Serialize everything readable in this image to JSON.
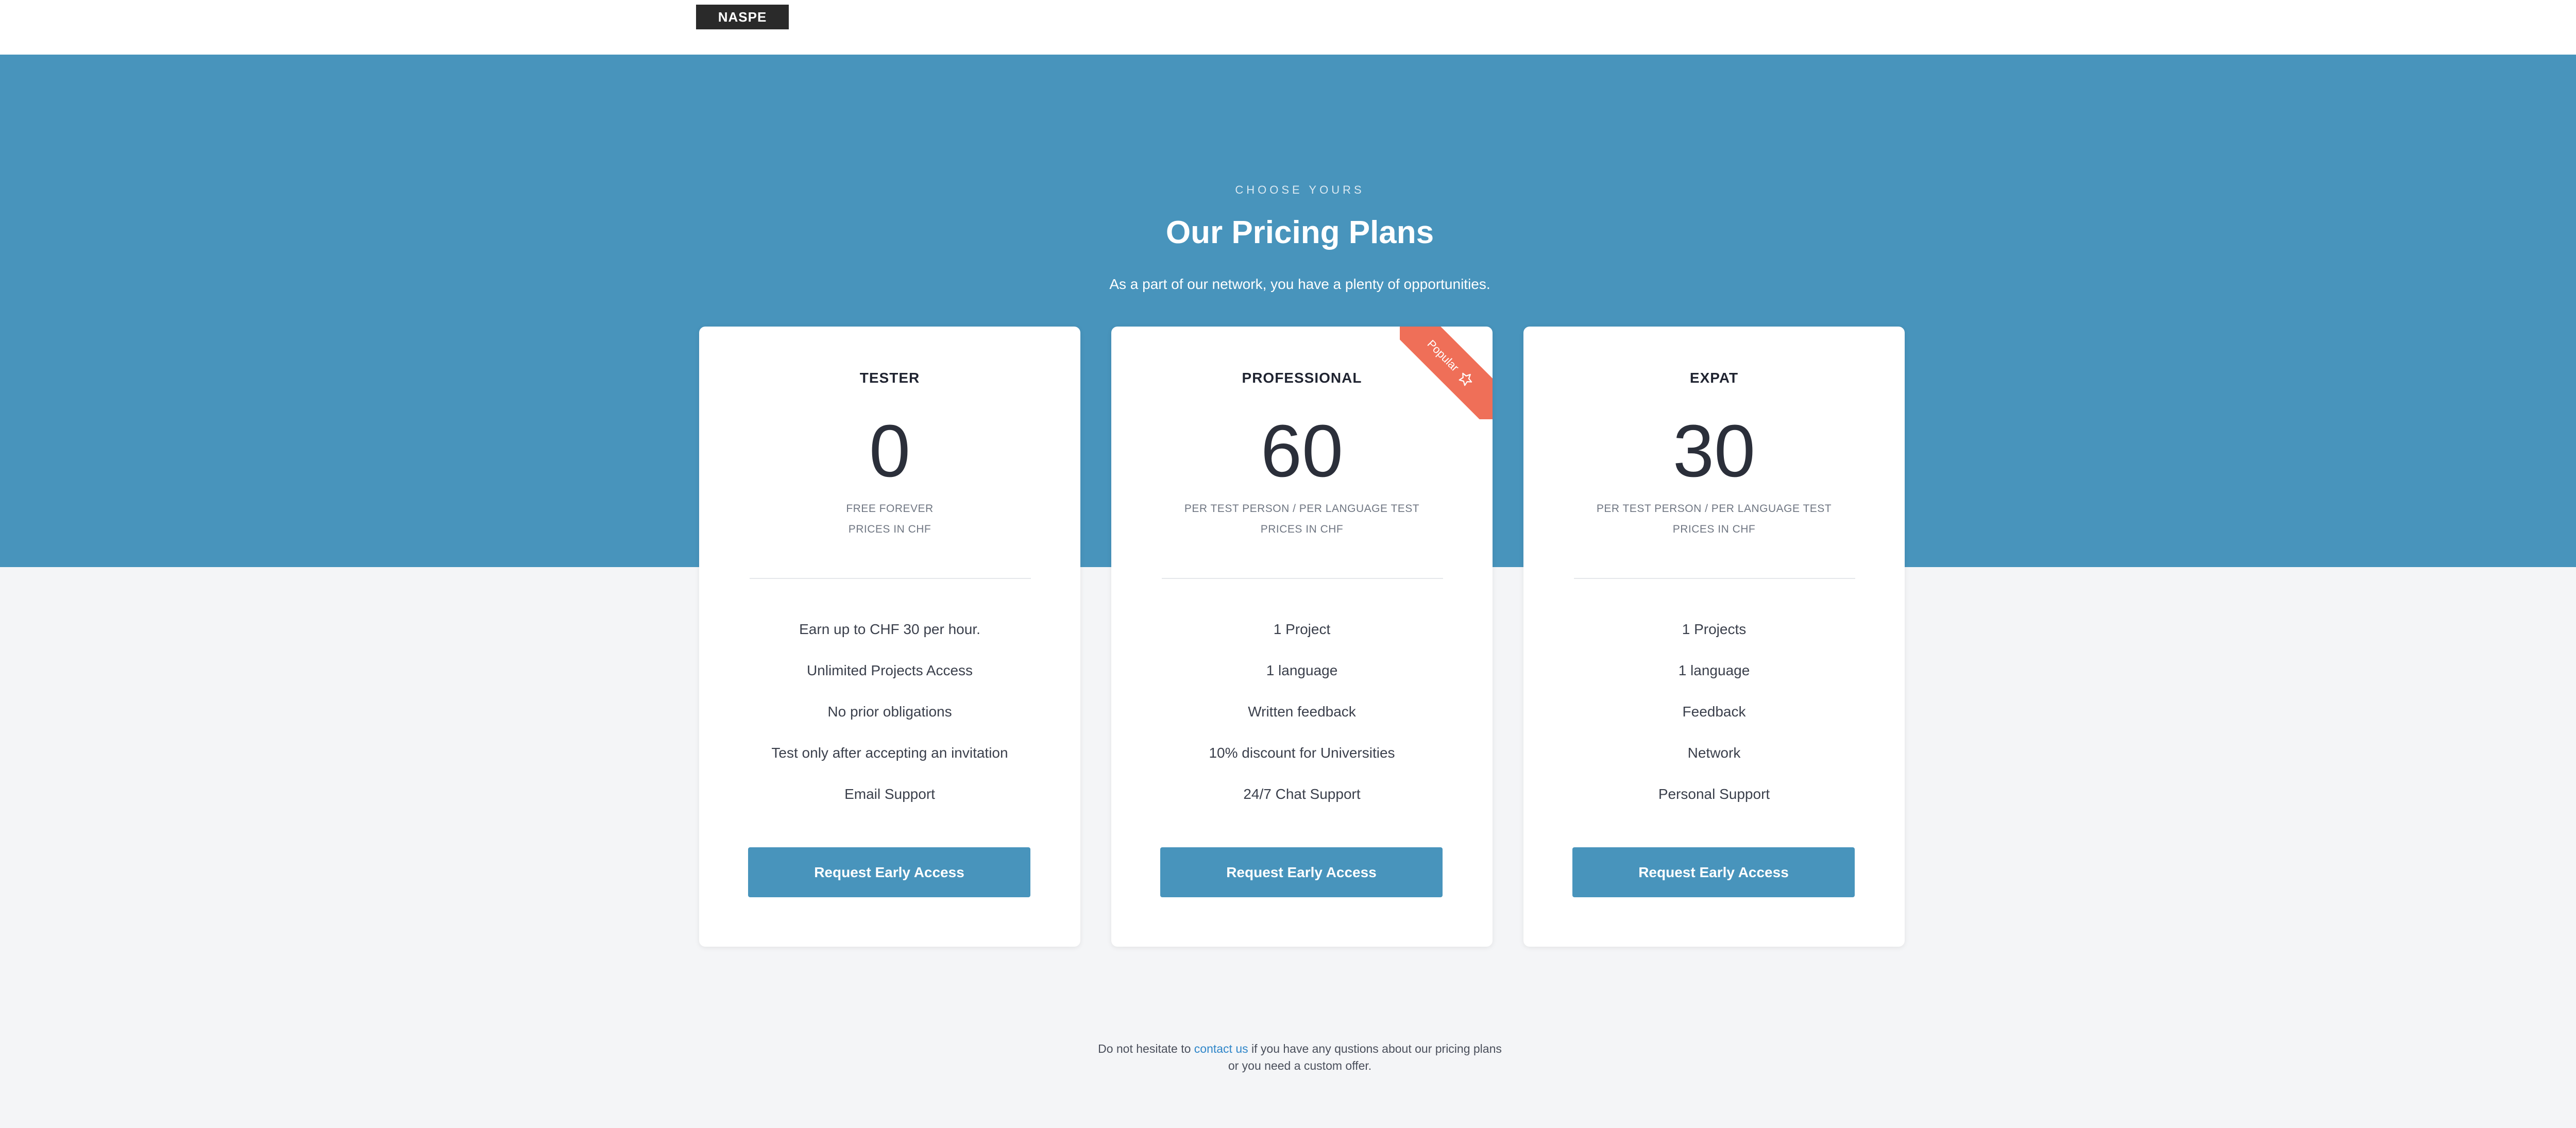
{
  "brand": {
    "logo": "NASPE"
  },
  "hero": {
    "eyebrow": "CHOOSE YOURS",
    "title": "Our Pricing Plans",
    "subtitle": "As a part of our network, you have a plenty of opportunities."
  },
  "plans": [
    {
      "name": "TESTER",
      "price": "0",
      "note1": "FREE FOREVER",
      "note2": "PRICES IN CHF",
      "features": [
        "Earn up to CHF 30 per hour.",
        "Unlimited Projects Access",
        "No prior obligations",
        "Test only after accepting an invitation",
        "Email Support"
      ],
      "cta": "Request Early Access"
    },
    {
      "name": "PROFESSIONAL",
      "price": "60",
      "note1": "PER TEST PERSON /  PER LANGUAGE TEST",
      "note2": "PRICES IN CHF",
      "features": [
        "1 Project",
        "1 language",
        "Written feedback",
        "10% discount for Universities",
        "24/7 Chat Support"
      ],
      "cta": "Request Early Access",
      "badge": "Popular"
    },
    {
      "name": "EXPAT",
      "price": "30",
      "note1": "PER TEST PERSON /  PER LANGUAGE TEST",
      "note2": "PRICES IN CHF",
      "features": [
        "1 Projects",
        "1 language",
        "Feedback",
        "Network",
        "Personal Support"
      ],
      "cta": "Request Early Access"
    }
  ],
  "footer": {
    "before": "Do not hesitate to ",
    "link": "contact us",
    "after": " if you have any qustions about our pricing plans or you need a custom offer."
  },
  "colors": {
    "hero": "#4894bc",
    "button": "#4894bc",
    "badge": "#ef6f58",
    "background": "#f4f5f7"
  },
  "icons": {
    "badge_icon": "star-icon"
  }
}
